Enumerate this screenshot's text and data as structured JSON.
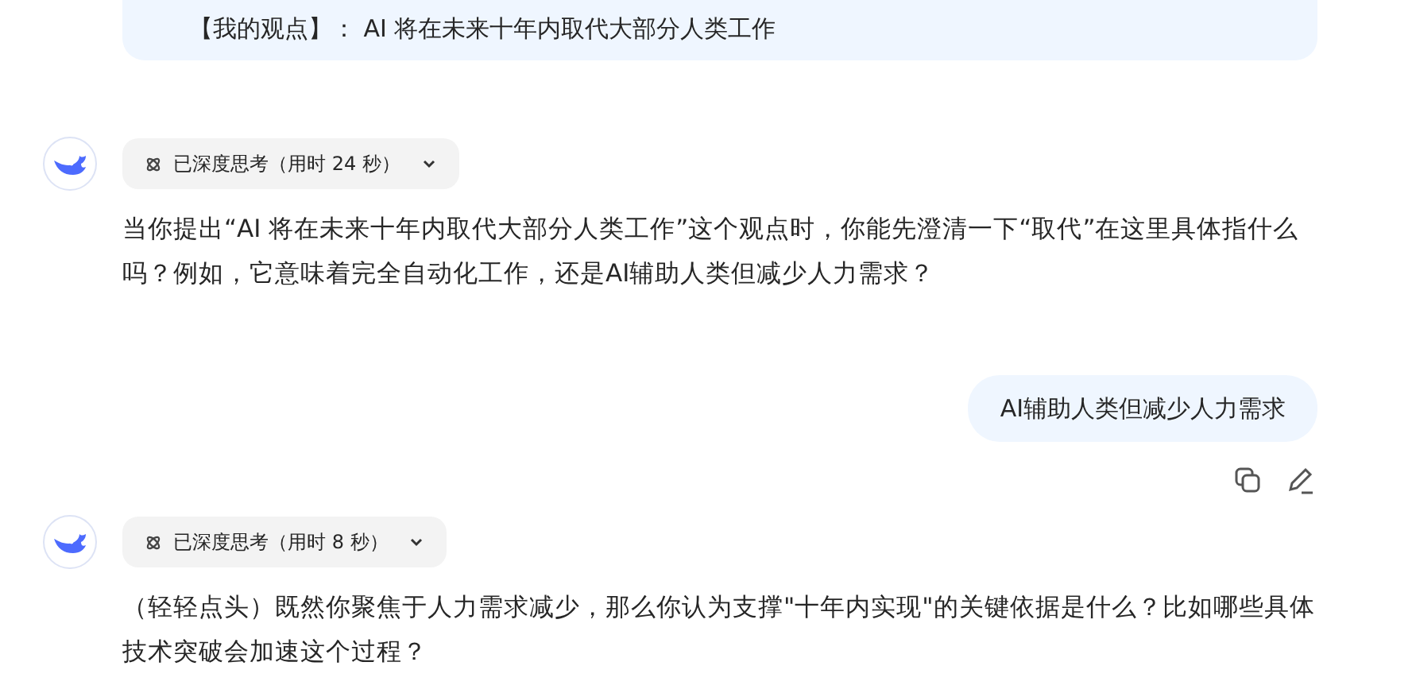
{
  "messages": [
    {
      "kind": "user",
      "text": "【我的观点】： AI 将在未来十年内取代大部分人类工作",
      "actions": false,
      "cut_top": true
    },
    {
      "kind": "assistant",
      "thinking": "已深度思考（用时 24 秒）",
      "expanded": false,
      "text": "当你提出“AI 将在未来十年内取代大部分人类工作”这个观点时，你能先澄清一下“取代”在这里具体指什么吗？例如，它意味着完全自动化工作，还是AI辅助人类但减少人力需求？"
    },
    {
      "kind": "user",
      "text": "AI辅助人类但减少人力需求",
      "actions": true,
      "cut_top": false
    },
    {
      "kind": "assistant",
      "thinking": "已深度思考（用时 8 秒）",
      "expanded": false,
      "text": "（轻轻点头）既然你聚焦于人力需求减少，那么你认为支撑\"十年内实现\"的关键依据是什么？比如哪些具体技术突破会加速这个过程？"
    }
  ]
}
